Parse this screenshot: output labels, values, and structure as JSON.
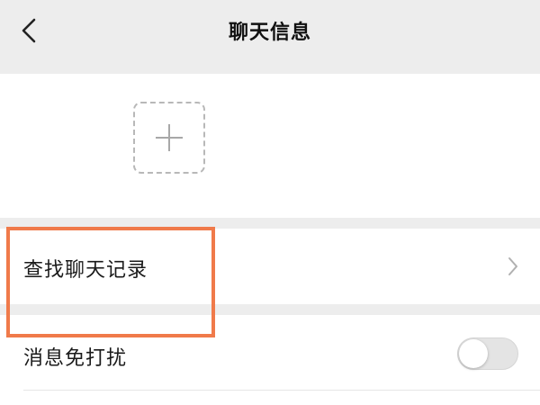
{
  "header": {
    "title": "聊天信息",
    "back_icon": "chevron-left-icon"
  },
  "members": {
    "add_icon": "plus-icon"
  },
  "settings": {
    "search_history_label": "查找聊天记录",
    "search_history_icon": "chevron-right-icon",
    "mute_label": "消息免打扰",
    "mute_enabled": false
  },
  "annotation": {
    "highlight_color": "#f07a4a"
  },
  "colors": {
    "background": "#ededed",
    "card": "#ffffff",
    "toggle_off": "#e4e4e4"
  }
}
